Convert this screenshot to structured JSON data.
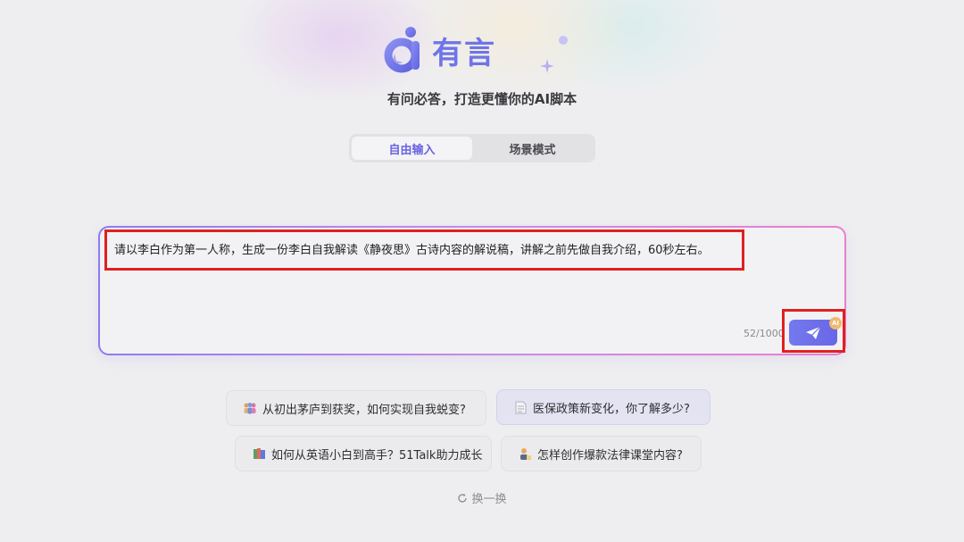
{
  "brand": {
    "logo_text": "有言",
    "tagline": "有问必答，打造更懂你的AI脚本"
  },
  "modes": [
    {
      "label": "自由输入",
      "active": true
    },
    {
      "label": "场景模式",
      "active": false
    }
  ],
  "input": {
    "value": "请以李白作为第一人称，生成一份李白自我解读《静夜思》古诗内容的解说稿，讲解之前先做自我介绍，60秒左右。",
    "char_count": "52/1000",
    "send_icon": "paper-plane-icon",
    "badge": "AI"
  },
  "suggestions": [
    {
      "label": "从初出茅庐到获奖，如何实现自我蜕变?",
      "icon": "people-icon"
    },
    {
      "label": "医保政策新变化，你了解多少?",
      "icon": "document-icon"
    },
    {
      "label": "如何从英语小白到高手？51Talk助力成长",
      "icon": "books-icon"
    },
    {
      "label": "怎样创作爆款法律课堂内容?",
      "icon": "person-writing-icon"
    }
  ],
  "refresh_label": "换一换",
  "colors": {
    "accent": "#6a63e0",
    "highlight_red": "#e02020"
  }
}
